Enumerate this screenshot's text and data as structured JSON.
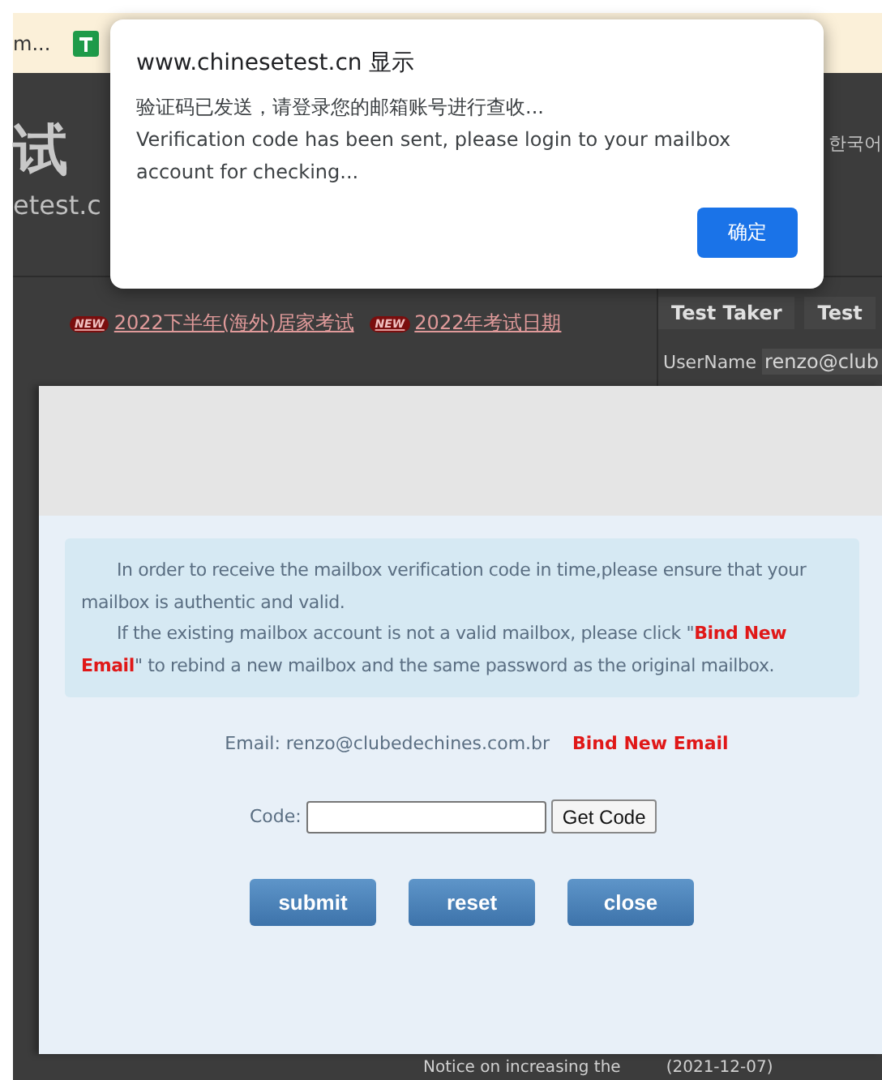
{
  "browser": {
    "bookmarks": [
      {
        "label": "m...",
        "kind": "text"
      },
      {
        "kind": "icon"
      }
    ]
  },
  "background_page": {
    "logo_text": "试",
    "domain": "etest.c",
    "language": "한국어",
    "news": [
      {
        "badge": "NEW",
        "label": "2022下半年(海外)居家考试"
      },
      {
        "badge": "NEW",
        "label": "2022年考试日期"
      }
    ],
    "tabs": [
      {
        "label": "Test Taker"
      },
      {
        "label": "Test"
      }
    ],
    "username_label": "UserName",
    "username_value": "renzo@club",
    "notice": "Notice on increasing the",
    "notice_date": "(2021-12-07)"
  },
  "alert": {
    "title": "www.chinesetest.cn 显示",
    "message_lines": [
      "验证码已发送，请登录您的邮箱账号进行查收...",
      "Verification code has been sent, please login to your mailbox account for checking..."
    ],
    "ok_button": "确定"
  },
  "modal": {
    "info": [
      "In order to receive the mailbox verification code in time,please ensure that your mailbox is authentic and valid.",
      "If the existing mailbox account is not a valid mailbox, please click \"**Bind New Email**\" to rebind a new mailbox and the same password as the original mailbox."
    ],
    "email_label": "Email: renzo@clubedechines.com.br",
    "bind_link": "Bind New Email",
    "code_label": "Code:",
    "get_code_button": "Get Code",
    "buttons": [
      "submit",
      "reset",
      "close"
    ]
  }
}
